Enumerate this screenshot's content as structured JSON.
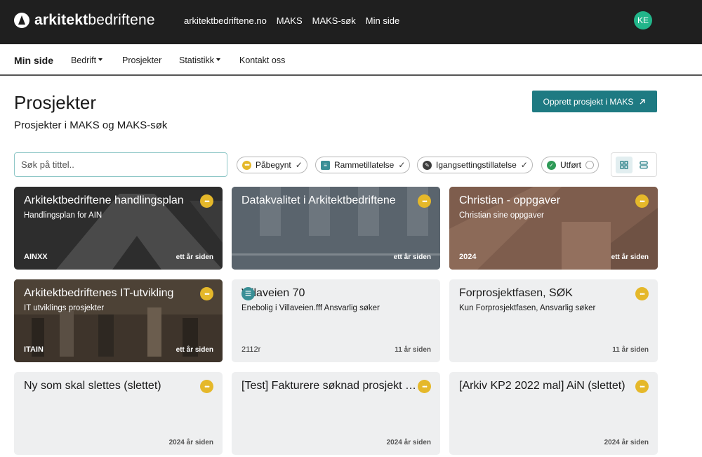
{
  "header": {
    "logo_bold": "arkitekt",
    "logo_light": "bedriftene",
    "links": [
      "arkitektbedriftene.no",
      "MAKS",
      "MAKS-søk",
      "Min side"
    ],
    "avatar_initials": "KE"
  },
  "subnav": {
    "items": [
      {
        "label": "Min side",
        "active": true,
        "dropdown": false
      },
      {
        "label": "Bedrift",
        "active": false,
        "dropdown": true
      },
      {
        "label": "Prosjekter",
        "active": false,
        "dropdown": false
      },
      {
        "label": "Statistikk",
        "active": false,
        "dropdown": true
      },
      {
        "label": "Kontakt oss",
        "active": false,
        "dropdown": false
      }
    ]
  },
  "page": {
    "title": "Prosjekter",
    "subtitle": "Prosjekter i MAKS og MAKS-søk",
    "create_button": "Opprett prosjekt i MAKS"
  },
  "search": {
    "placeholder": "Søk på tittel.."
  },
  "filters": [
    {
      "label": "Påbegynt",
      "checked": true,
      "color": "#e5b82a",
      "icon": "dots-icon"
    },
    {
      "label": "Rammetillatelse",
      "checked": true,
      "color": "#3a8f96",
      "icon": "clipboard-icon"
    },
    {
      "label": "Igangsettingstillatelse",
      "checked": true,
      "color": "#3d3d3d",
      "icon": "wrench-icon"
    },
    {
      "label": "Utført",
      "checked": false,
      "color": "#2e9a57",
      "icon": "check-icon"
    }
  ],
  "view": {
    "grid_active": true
  },
  "cards": [
    {
      "title": "Arkitektbedriftene handlingsplan",
      "subtitle": "Handlingsplan for AIN",
      "code": "AINXX",
      "updated": "ett år siden",
      "status": "pabegynt",
      "theme": "logo-dark"
    },
    {
      "title": "Datakvalitet i Arkitektbedriftene",
      "subtitle": "",
      "code": "",
      "updated": "ett år siden",
      "status": "pabegynt",
      "theme": "building-grey"
    },
    {
      "title": "Christian - oppgaver",
      "subtitle": "Christian sine oppgaver",
      "code": "2024",
      "updated": "ett år siden",
      "status": "pabegynt",
      "theme": "brick"
    },
    {
      "title": "Arkitektbedriftenes IT-utvikling",
      "subtitle": "IT utviklings prosjekter",
      "code": "ITAIN",
      "updated": "ett år siden",
      "status": "pabegynt",
      "theme": "office"
    },
    {
      "title": "Villaveien 70",
      "subtitle": "Enebolig i Villaveien.fff Ansvarlig søker",
      "code": "2112r",
      "updated": "11 år siden",
      "status": "rammetillatelse",
      "theme": "light"
    },
    {
      "title": "Forprosjektfasen, SØK",
      "subtitle": "Kun Forprosjektfasen, Ansvarlig søker",
      "code": "",
      "updated": "11 år siden",
      "status": "pabegynt",
      "theme": "light"
    },
    {
      "title": "Ny som skal slettes (slettet)",
      "subtitle": "",
      "code": "",
      "updated": "2024 år siden",
      "status": "pabegynt",
      "theme": "light"
    },
    {
      "title": "[Test] Fakturere søknad prosjekt (slettet)",
      "subtitle": "",
      "code": "",
      "updated": "2024 år siden",
      "status": "pabegynt",
      "theme": "light"
    },
    {
      "title": "[Arkiv KP2 2022 mal] AiN (slettet)",
      "subtitle": "",
      "code": "",
      "updated": "2024 år siden",
      "status": "pabegynt",
      "theme": "light"
    }
  ]
}
